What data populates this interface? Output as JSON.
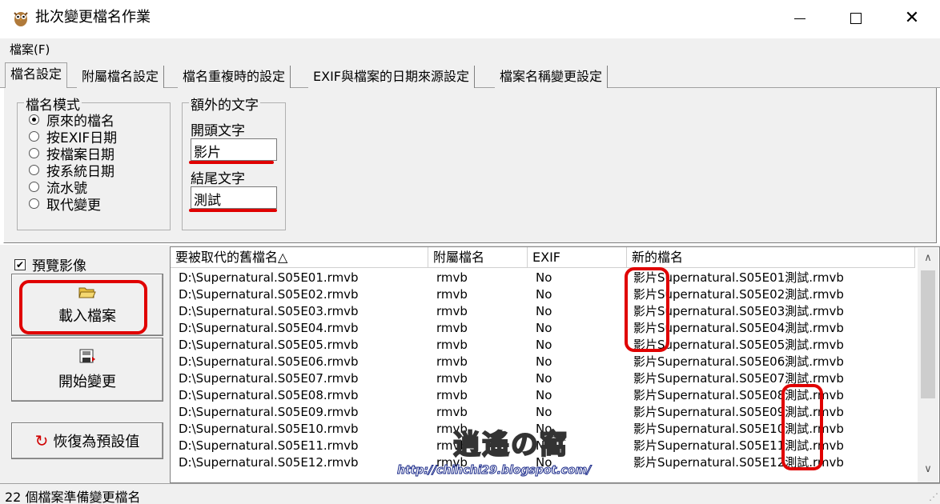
{
  "window": {
    "title": "批次變更檔名作業"
  },
  "menu": {
    "file": "檔案(F)"
  },
  "tabs": [
    "檔名設定",
    "附屬檔名設定",
    "檔名重複時的設定",
    "EXIF與檔案的日期來源設定",
    "檔案名稱變更設定"
  ],
  "name_mode": {
    "legend": "檔名模式",
    "options": [
      "原來的檔名",
      "按EXIF日期",
      "按檔案日期",
      "按系統日期",
      "流水號",
      "取代變更"
    ],
    "selected": "原來的檔名"
  },
  "extra_text": {
    "legend": "額外的文字",
    "prefix_label": "開頭文字",
    "prefix_value": "影片",
    "suffix_label": "結尾文字",
    "suffix_value": "測試"
  },
  "preview": {
    "label": "預覽影像",
    "checked": true
  },
  "buttons": {
    "load": "載入檔案",
    "start": "開始變更",
    "restore": "恢復為預設值"
  },
  "list": {
    "columns": [
      "要被取代的舊檔名△",
      "附屬檔名",
      "EXIF",
      "新的檔名"
    ],
    "rows": [
      [
        "D:\\Supernatural.S05E01.rmvb",
        "rmvb",
        "No",
        "影片Supernatural.S05E01測試.rmvb"
      ],
      [
        "D:\\Supernatural.S05E02.rmvb",
        "rmvb",
        "No",
        "影片Supernatural.S05E02測試.rmvb"
      ],
      [
        "D:\\Supernatural.S05E03.rmvb",
        "rmvb",
        "No",
        "影片Supernatural.S05E03測試.rmvb"
      ],
      [
        "D:\\Supernatural.S05E04.rmvb",
        "rmvb",
        "No",
        "影片Supernatural.S05E04測試.rmvb"
      ],
      [
        "D:\\Supernatural.S05E05.rmvb",
        "rmvb",
        "No",
        "影片Supernatural.S05E05測試.rmvb"
      ],
      [
        "D:\\Supernatural.S05E06.rmvb",
        "rmvb",
        "No",
        "影片Supernatural.S05E06測試.rmvb"
      ],
      [
        "D:\\Supernatural.S05E07.rmvb",
        "rmvb",
        "No",
        "影片Supernatural.S05E07測試.rmvb"
      ],
      [
        "D:\\Supernatural.S05E08.rmvb",
        "rmvb",
        "No",
        "影片Supernatural.S05E08測試.rmvb"
      ],
      [
        "D:\\Supernatural.S05E09.rmvb",
        "rmvb",
        "No",
        "影片Supernatural.S05E09測試.rmvb"
      ],
      [
        "D:\\Supernatural.S05E10.rmvb",
        "rmvb",
        "No",
        "影片Supernatural.S05E10測試.rmvb"
      ],
      [
        "D:\\Supernatural.S05E11.rmvb",
        "rmvb",
        "No",
        "影片Supernatural.S05E11測試.rmvb"
      ],
      [
        "D:\\Supernatural.S05E12.rmvb",
        "rmvb",
        "No",
        "影片Supernatural.S05E12測試.rmvb"
      ]
    ]
  },
  "watermark": {
    "logo": "逍遙の窩",
    "url": "http://chihchi29.blogspot.com/"
  },
  "status": {
    "text": "22 個檔案準備變更檔名"
  },
  "icons": {
    "app": "owl-icon",
    "load": "open-folder-icon",
    "start": "save-disk-icon",
    "restore": "refresh-icon"
  },
  "colors": {
    "highlight": "#e00000",
    "face": "#f0f0f0"
  }
}
